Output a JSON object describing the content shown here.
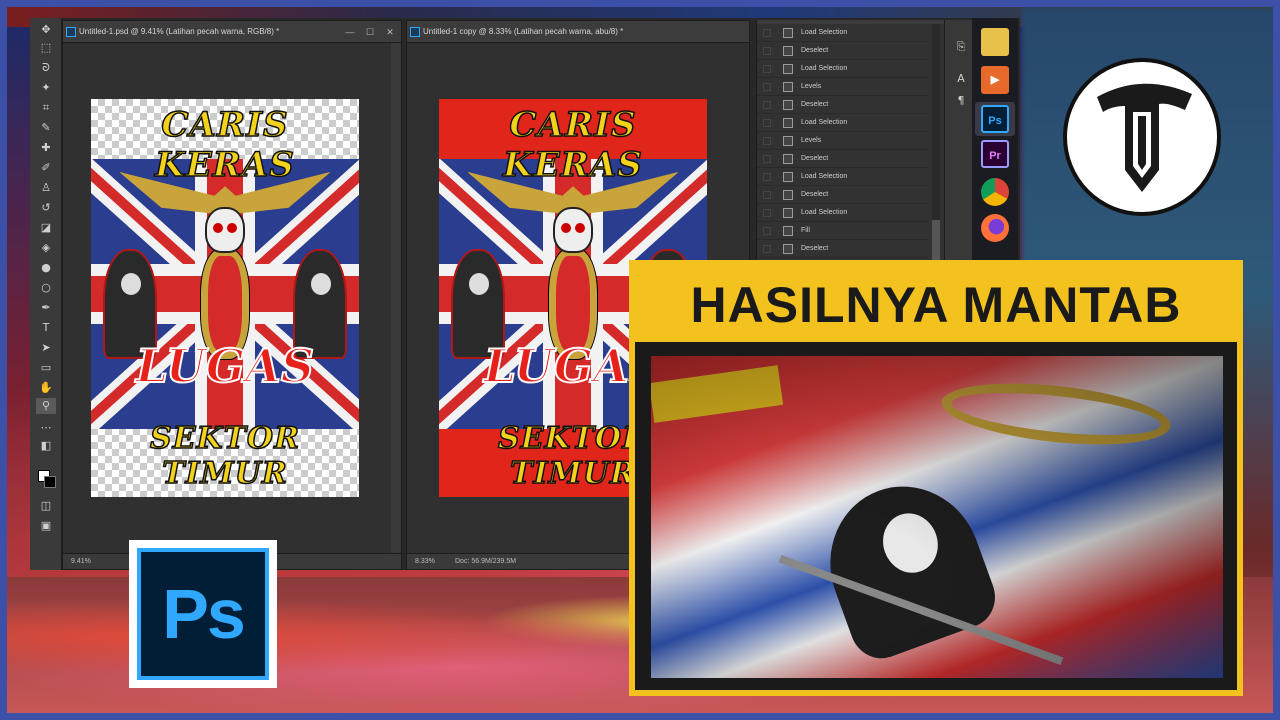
{
  "doc1": {
    "tab_title": "Untitled-1.psd @ 9.41% (Latihan pecah warna, RGB/8) *",
    "zoom": "9.41%"
  },
  "doc2": {
    "tab_title": "Untitled-1 copy @ 8.33% (Latihan pecah warna, abu/8) *",
    "zoom": "8.33%",
    "doc_info": "Doc: 56.9M/239.5M"
  },
  "artwork": {
    "top_text": "CARIS KERAS",
    "mid_text": "LUGAS",
    "bottom_text": "SEKTOR TIMUR"
  },
  "history": {
    "items": [
      "Load Selection",
      "Deselect",
      "Load Selection",
      "Levels",
      "Deselect",
      "Load Selection",
      "Levels",
      "Deselect",
      "Load Selection",
      "Deselect",
      "Load Selection",
      "Fill",
      "Deselect"
    ]
  },
  "ps_logo": {
    "text": "Ps"
  },
  "taskbar": {
    "ps_label": "Ps",
    "pr_label": "Pr"
  },
  "callout": {
    "title": "HASILNYA MANTAB"
  },
  "colors": {
    "callout_yellow": "#f4c21e",
    "ps_blue": "#31a8ff",
    "ps_dark": "#001e36",
    "frame_blue": "#3d50a8"
  }
}
